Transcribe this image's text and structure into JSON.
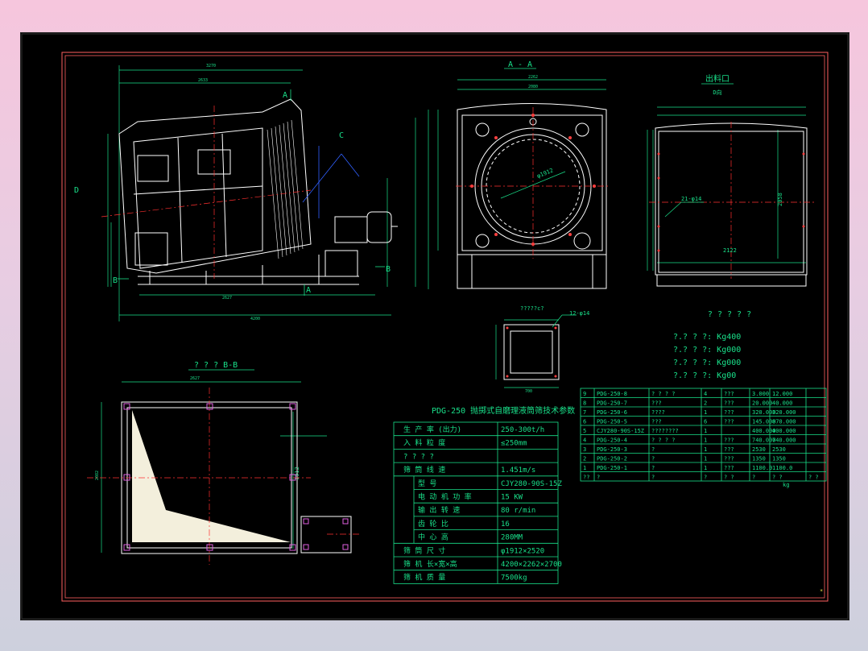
{
  "views": {
    "section_aa": "A - A",
    "section_bb": "? ? ?  B-B",
    "outlet_view_title": "出料口",
    "outlet_view_sub": "D向",
    "hopper_note": "?????c?",
    "side_note": "12-φ14",
    "front_diameter": "φ1912",
    "outlet_holes": "21-φ14",
    "outlet_height": "2058",
    "outlet_width": "2122",
    "bb_diameter": "1912",
    "label_A": "A",
    "label_B": "B",
    "label_C": "C",
    "label_D": "D"
  },
  "weights_block": {
    "header": "? ? ? ? ?",
    "rows": [
      "?.? ? ?: Kg400",
      "?.? ? ?: Kg000",
      "?.? ? ?: Kg000",
      "?.? ? ?: Kg00"
    ]
  },
  "spec_table": {
    "title": "PDG-250 抛掷式自磨理液筒筛技术参数",
    "rows": [
      [
        "生 产 率  (出力)",
        "250-300t/h"
      ],
      [
        "入 料 粒 度",
        "≤250mm"
      ],
      [
        "? ? ? ?",
        ""
      ],
      [
        "筛 筒 线 速",
        "1.451m/s"
      ],
      [
        "型    号",
        "CJY280-90S-15Z"
      ],
      [
        "电 动 机 功 率",
        "15 KW"
      ],
      [
        "输 出 转 速",
        "80 r/min"
      ],
      [
        "齿 轮 比",
        "16"
      ],
      [
        "中 心 高",
        "280MM"
      ],
      [
        "筛 筒 尺 寸",
        "φ1912×2520"
      ],
      [
        "筛 机  长×宽×高",
        "4200×2262×2700"
      ],
      [
        "筛 机 质 量",
        "7500kg"
      ]
    ]
  },
  "parts_table": {
    "rows": [
      [
        "9",
        "PDG-250-8",
        "? ? ? ?",
        "4",
        "???",
        "3.000",
        "12.000"
      ],
      [
        "8",
        "PDG-250-7",
        "???",
        "2",
        "???",
        "20.000",
        "40.000"
      ],
      [
        "7",
        "PDG-250-6",
        "????",
        "1",
        "???",
        "320.000",
        "320.000"
      ],
      [
        "6",
        "PDG-250-5",
        "???",
        "6",
        "???",
        "145.000",
        "870.000"
      ],
      [
        "5",
        "CJY280-90S-15Z",
        "????????",
        "1",
        "",
        "400.000",
        "400.000"
      ],
      [
        "4",
        "PDG-250-4",
        "? ? ? ?",
        "1",
        "???",
        "740.000",
        "740.000"
      ],
      [
        "3",
        "PDG-250-3",
        "?",
        "1",
        "???",
        "2530",
        "2530"
      ],
      [
        "2",
        "PDG-250-2",
        "?",
        "1",
        "???",
        "1350",
        "1350"
      ],
      [
        "1",
        "PDG-250-1",
        "?",
        "1",
        "???",
        "1100.0",
        "1100.0"
      ]
    ],
    "footer": [
      "??",
      "?",
      "?",
      "?",
      "? ?",
      "?",
      "?  ?",
      "? ?"
    ],
    "footer_unit": "kg"
  },
  "dims": {
    "overall_length": "3270",
    "inner_length": "2633",
    "base_length": "2627",
    "total_length": "4200",
    "front_width": "2262",
    "front_inner": "2080",
    "bb_width": "2627",
    "bb_height": "2082",
    "hopper_size": "700"
  }
}
